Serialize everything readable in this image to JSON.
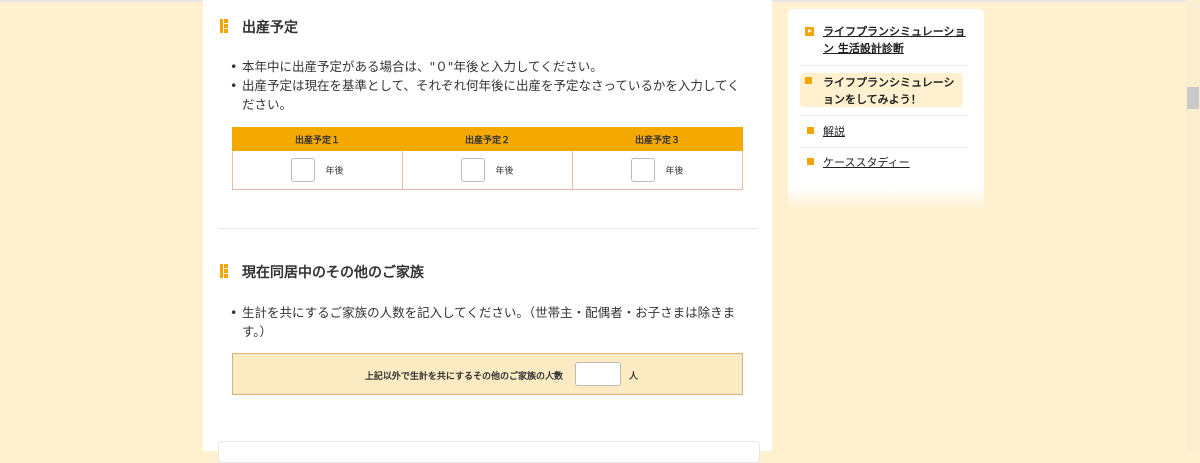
{
  "birth_section": {
    "title": "出産予定",
    "bullets": [
      "本年中に出産予定がある場合は、\"０\"年後と入力してください。",
      "出産予定は現在を基準として、それぞれ何年後に出産を予定なさっているかを入力してください。"
    ],
    "columns": [
      "出産予定１",
      "出産予定２",
      "出産予定３"
    ],
    "unit": "年後",
    "values": [
      "",
      "",
      ""
    ]
  },
  "family_section": {
    "title": "現在同居中のその他のご家族",
    "bullets": [
      "生計を共にするご家族の人数を記入してください。（世帯主・配偶者・お子さまは除きます。）"
    ],
    "row_label": "上記以外で生計を共にするその他のご家族の人数",
    "arrow": "→",
    "value": "",
    "unit": "人"
  },
  "sidebar": {
    "header_link": "ライフプランシミュレーション 生活設計診断",
    "active_item": "ライフプランシミュレーションをしてみよう！",
    "items": [
      "解説",
      "ケーススタディー"
    ]
  },
  "colors": {
    "accent": "#f3a600",
    "page_bg": "#fff1cf",
    "row_bg": "#fcebc2"
  }
}
